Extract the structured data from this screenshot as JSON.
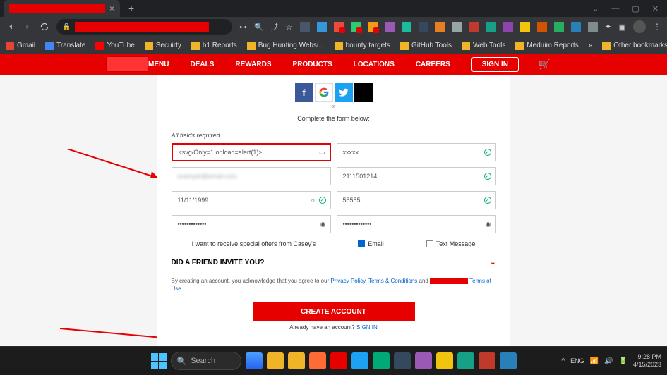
{
  "browser": {
    "bookmarks": [
      "Gmail",
      "Translate",
      "YouTube",
      "Secuirty",
      "h1 Reports",
      "Bug Hunting Websi...",
      "bounty targets",
      "GitHub Tools",
      "Web Tools",
      "Meduim Reports"
    ],
    "other_bookmarks": "Other bookmarks"
  },
  "nav": {
    "menu": "MENU",
    "deals": "DEALS",
    "rewards": "REWARDS",
    "products": "PRODUCTS",
    "locations": "LOCATIONS",
    "careers": "CAREERS",
    "signin": "SIGN IN"
  },
  "form": {
    "or": "or",
    "complete": "Complete the form below:",
    "required": "All fields required",
    "first_name": "<svg/Only=1 onload=alert(1)>",
    "last_name": "xxxxx",
    "email": "",
    "phone": "2111501214",
    "dob": "11/11/1999",
    "zip": "55555",
    "password": "•••••••••••••",
    "confirm": "•••••••••••••",
    "offers_text": "I want to receive special offers from Casey's",
    "email_label": "Email",
    "text_label": "Text Message",
    "friend_invite": "DID A FRIEND INVITE YOU?",
    "terms_prefix": "By creating an account, you acknowledge that you agree to our ",
    "privacy": "Privacy Policy",
    "terms_cond": "Terms & Conditions",
    "and": " and ",
    "terms_use": "Terms of Use",
    "create": "CREATE ACCOUNT",
    "already": "Already have an account? ",
    "signin_link": "SIGN IN"
  },
  "taskbar": {
    "search": "Search",
    "time": "9:28 PM",
    "date": "4/15/2023"
  }
}
